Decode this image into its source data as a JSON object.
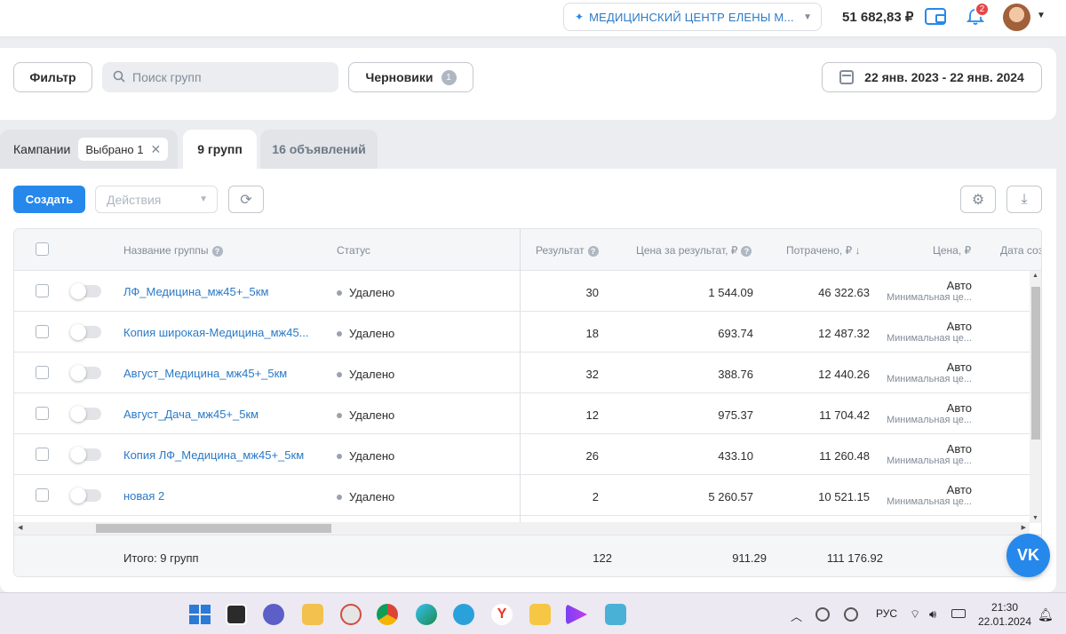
{
  "header": {
    "account_name": "МЕДИЦИНСКИЙ ЦЕНТР ЕЛЕНЫ М...",
    "balance": "51 682,83 ₽",
    "notifications_count": "2"
  },
  "filters": {
    "filter_label": "Фильтр",
    "search_placeholder": "Поиск групп",
    "drafts_label": "Черновики",
    "drafts_count": "1",
    "date_range": "22 янв. 2023 - 22 янв. 2024"
  },
  "tabs": {
    "campaigns_label": "Кампании",
    "selected_chip": "Выбрано 1",
    "groups_label": "9 групп",
    "ads_label": "16 объявлений"
  },
  "toolbar": {
    "create_label": "Создать",
    "actions_placeholder": "Действия"
  },
  "table": {
    "columns": {
      "name": "Название группы",
      "status": "Статус",
      "result": "Результат",
      "cost_per_result": "Цена за результат, ₽",
      "spent": "Потрачено, ₽ ↓",
      "bid": "Цена, ₽",
      "created": "Дата соз"
    },
    "rows": [
      {
        "name": "ЛФ_Медицина_мж45+_5км",
        "status": "Удалено",
        "result": "30",
        "cost": "1 544.09",
        "spent": "46 322.63",
        "bid": "Авто",
        "bid_sub": "Минимальная це..."
      },
      {
        "name": "Копия широкая-Медицина_мж45...",
        "status": "Удалено",
        "result": "18",
        "cost": "693.74",
        "spent": "12 487.32",
        "bid": "Авто",
        "bid_sub": "Минимальная це..."
      },
      {
        "name": "Август_Медицина_мж45+_5км",
        "status": "Удалено",
        "result": "32",
        "cost": "388.76",
        "spent": "12 440.26",
        "bid": "Авто",
        "bid_sub": "Минимальная це..."
      },
      {
        "name": "Август_Дача_мж45+_5км",
        "status": "Удалено",
        "result": "12",
        "cost": "975.37",
        "spent": "11 704.42",
        "bid": "Авто",
        "bid_sub": "Минимальная це..."
      },
      {
        "name": "Копия ЛФ_Медицина_мж45+_5км",
        "status": "Удалено",
        "result": "26",
        "cost": "433.10",
        "spent": "11 260.48",
        "bid": "Авто",
        "bid_sub": "Минимальная це..."
      },
      {
        "name": "новая 2",
        "status": "Удалено",
        "result": "2",
        "cost": "5 260.57",
        "spent": "10 521.15",
        "bid": "Авто",
        "bid_sub": "Минимальная це..."
      }
    ],
    "totals": {
      "label": "Итого: 9 групп",
      "result": "122",
      "cost": "911.29",
      "spent": "111 176.92"
    }
  },
  "fab": {
    "label": "VK"
  },
  "taskbar": {
    "lang": "РУС",
    "time": "21:30",
    "date": "22.01.2024"
  },
  "colors": {
    "accent": "#2688eb",
    "link": "#2a7ac6",
    "badge": "#e64646"
  }
}
